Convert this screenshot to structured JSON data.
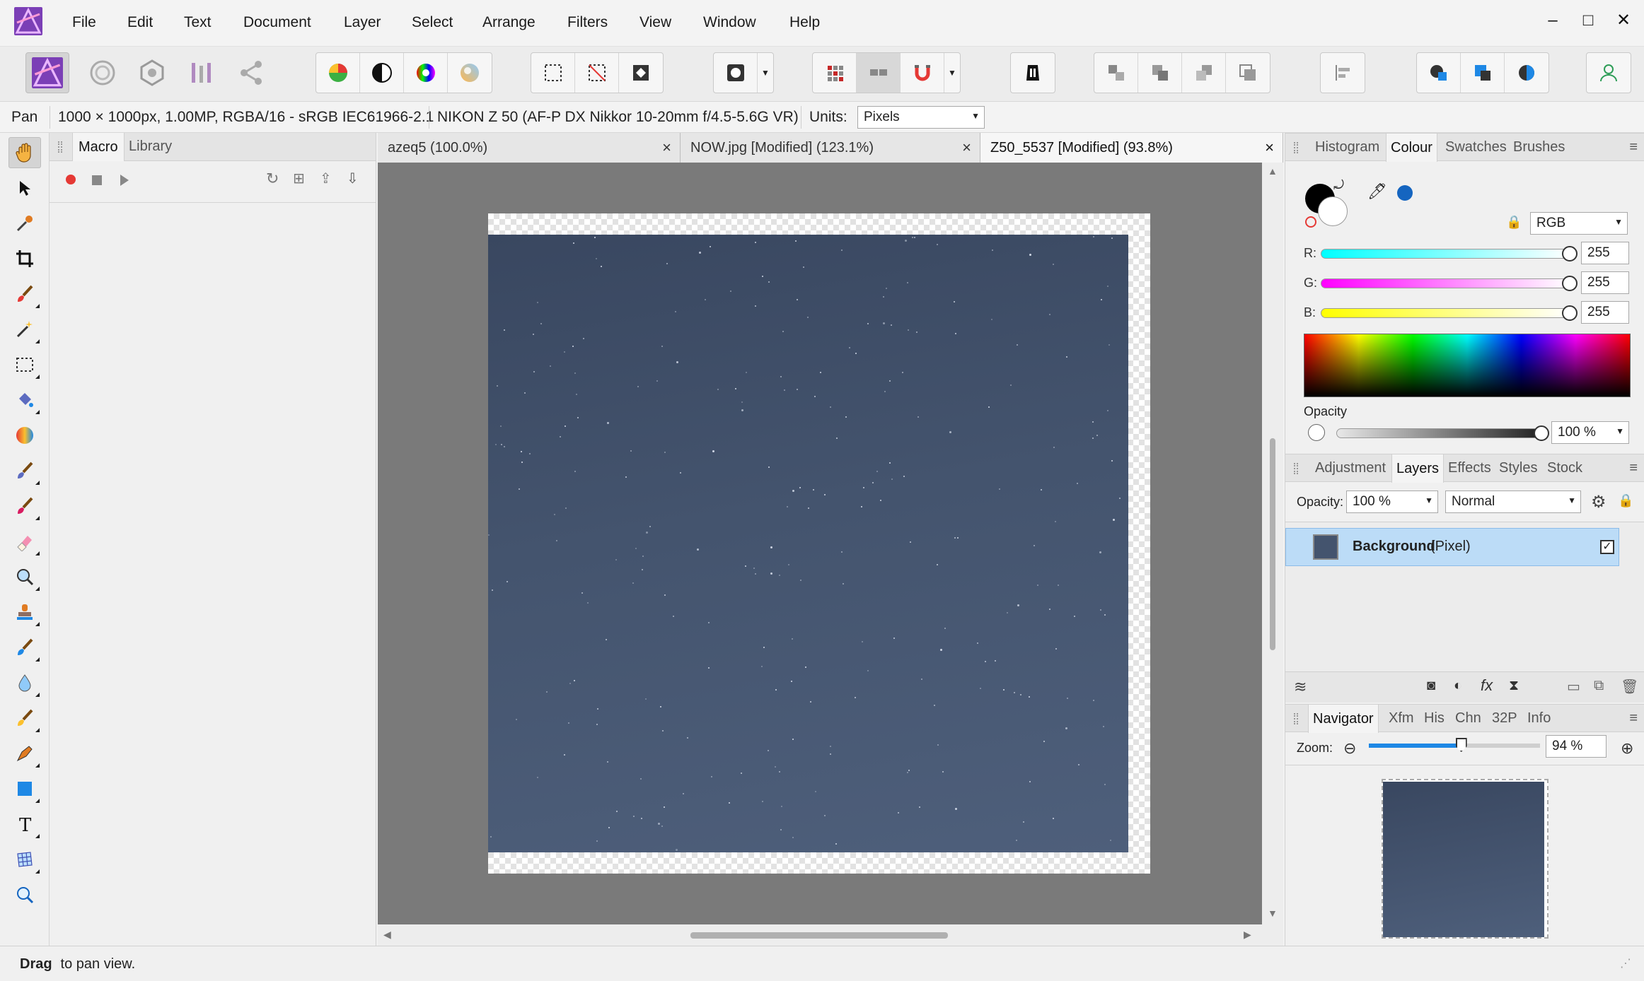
{
  "menu": [
    "File",
    "Edit",
    "Text",
    "Document",
    "Layer",
    "Select",
    "Arrange",
    "Filters",
    "View",
    "Window",
    "Help"
  ],
  "window_controls": {
    "minimize": "–",
    "maximize": "□",
    "close": "✕"
  },
  "context_bar": {
    "tool_name": "Pan",
    "doc_info": "1000 × 1000px, 1.00MP, RGBA/16 - sRGB IEC61966-2.1",
    "camera_info": "NIKON Z 50 (AF-P DX Nikkor 10-20mm f/4.5-5.6G VR)",
    "units_label": "Units:",
    "units_value": "Pixels"
  },
  "left_panel": {
    "tabs": [
      "Macro",
      "Library"
    ],
    "active_tab": "Macro"
  },
  "document_tabs": [
    {
      "title": "azeq5 (100.0%)",
      "active": false
    },
    {
      "title": "NOW.jpg [Modified] (123.1%)",
      "active": false
    },
    {
      "title": "Z50_5537 [Modified] (93.8%)",
      "active": true
    }
  ],
  "colour_panel": {
    "tabs": [
      "Histogram",
      "Colour",
      "Swatches",
      "Brushes"
    ],
    "active_tab": "Colour",
    "mode": "RGB",
    "r_label": "R:",
    "r_value": "255",
    "r_fraction": 1.0,
    "g_label": "G:",
    "g_value": "255",
    "g_fraction": 1.0,
    "b_label": "B:",
    "b_value": "255",
    "b_fraction": 1.0,
    "opacity_label": "Opacity",
    "opacity_value": "100 %",
    "opacity_fraction": 1.0,
    "accent_color": "#1565c0"
  },
  "layers_panel": {
    "tabs": [
      "Adjustment",
      "Layers",
      "Effects",
      "Styles",
      "Stock"
    ],
    "active_tab": "Layers",
    "opacity_label": "Opacity:",
    "opacity_value": "100 %",
    "blend_mode": "Normal",
    "layers": [
      {
        "name": "Background",
        "type": "(Pixel)",
        "visible": true,
        "selected": true
      }
    ]
  },
  "navigator_panel": {
    "tabs": [
      "Navigator",
      "Xfm",
      "His",
      "Chn",
      "32P",
      "Info"
    ],
    "active_tab": "Navigator",
    "zoom_label": "Zoom:",
    "zoom_value": "94 %",
    "zoom_fraction": 0.54
  },
  "status": {
    "bold": "Drag",
    "rest": " to pan view."
  },
  "icons": {
    "persona_photo": "affinity-photo-persona-icon",
    "liquify": "liquify-persona-icon",
    "develop": "develop-persona-icon",
    "tone_map": "tone-mapping-persona-icon",
    "export": "export-persona-icon"
  }
}
